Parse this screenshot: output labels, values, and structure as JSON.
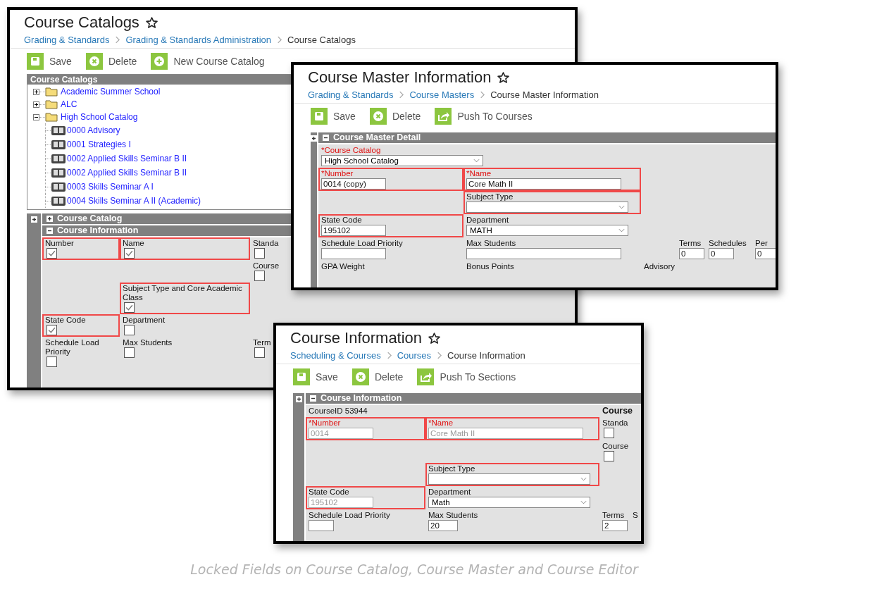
{
  "panels": [
    {
      "kind": "catalog",
      "title": "Course Catalogs",
      "breadcrumb": [
        "Grading & Standards",
        "Grading & Standards Administration",
        "Course Catalogs"
      ],
      "toolbar": [
        {
          "kind": "save",
          "label": "Save"
        },
        {
          "kind": "delete",
          "label": "Delete"
        },
        {
          "kind": "add",
          "label": "New Course Catalog"
        }
      ],
      "tree": {
        "title": "Course Catalogs",
        "items": [
          {
            "kind": "folder",
            "label": "Academic Summer School",
            "expanded": false
          },
          {
            "kind": "folder",
            "label": "ALC",
            "expanded": false
          },
          {
            "kind": "folder",
            "label": "High School Catalog",
            "expanded": true,
            "children": [
              {
                "kind": "course",
                "label": "0000 Advisory"
              },
              {
                "kind": "course",
                "label": "0001 Strategies I"
              },
              {
                "kind": "course",
                "label": "0002 Applied Skills Seminar B II"
              },
              {
                "kind": "course",
                "label": "0002 Applied Skills Seminar B II"
              },
              {
                "kind": "course",
                "label": "0003 Skills Seminar A I"
              },
              {
                "kind": "course",
                "label": "0004 Skills Seminar A II (Academic)"
              }
            ]
          }
        ]
      },
      "sections": [
        {
          "label": "Course Catalog",
          "expanded": false
        },
        {
          "label": "Course Information",
          "expanded": true
        }
      ],
      "rows": [
        [
          {
            "kind": "checkbox",
            "label": "Number",
            "checked": true,
            "locked": true
          },
          {
            "kind": "checkbox",
            "label": "Name",
            "checked": true,
            "locked": true
          },
          {
            "kind": "checkbox",
            "label": "Standa",
            "checked": false,
            "locked": false
          }
        ],
        [
          "",
          "",
          {
            "kind": "checkbox",
            "label": "Course",
            "checked": false,
            "locked": false
          }
        ],
        [
          "",
          {
            "kind": "checkbox",
            "label": "Subject Type and Core Academic Class",
            "checked": true,
            "locked": true
          }
        ],
        [
          {
            "kind": "checkbox",
            "label": "State Code",
            "checked": true,
            "locked": true
          },
          {
            "kind": "checkbox",
            "label": "Department",
            "checked": false,
            "locked": false
          }
        ],
        [
          {
            "kind": "checkbox",
            "label": "Schedule Load Priority",
            "checked": false,
            "locked": false
          },
          {
            "kind": "checkbox",
            "label": "Max Students",
            "checked": false,
            "locked": false
          },
          {
            "kind": "checkbox",
            "label": "Term",
            "checked": false,
            "locked": false
          }
        ]
      ]
    },
    {
      "kind": "master",
      "title": "Course Master Information",
      "breadcrumb": [
        "Grading & Standards",
        "Course Masters",
        "Course Master Information"
      ],
      "toolbar": [
        {
          "kind": "save",
          "label": "Save"
        },
        {
          "kind": "delete",
          "label": "Delete"
        },
        {
          "kind": "push",
          "label": "Push To Courses"
        }
      ],
      "sections": [
        {
          "label": "Course Master Detail",
          "expanded": true
        }
      ],
      "rows": [
        [
          {
            "kind": "select",
            "label": "*Course Catalog",
            "value": "High School Catalog",
            "required": true,
            "locked": false
          }
        ],
        [
          {
            "kind": "input",
            "label": "*Number",
            "value": "0014 (copy)",
            "required": true,
            "locked": true,
            "disabled": false
          },
          {
            "kind": "input",
            "label": "*Name",
            "value": "Core Math II",
            "required": true,
            "locked": true,
            "disabled": false
          }
        ],
        [
          "",
          {
            "kind": "select",
            "label": "Subject Type",
            "required": false,
            "locked": true
          }
        ],
        [
          {
            "kind": "input",
            "label": "State Code",
            "value": "195102",
            "required": false,
            "locked": true,
            "disabled": false
          },
          {
            "kind": "select",
            "label": "Department",
            "value": "MATH",
            "required": false,
            "locked": false
          }
        ],
        [
          {
            "kind": "input",
            "label": "Schedule Load Priority",
            "required": false,
            "locked": false,
            "disabled": false
          },
          {
            "kind": "input",
            "label": "Max Students",
            "required": false,
            "locked": false,
            "disabled": false
          },
          "",
          {
            "kind": "input",
            "label": "Terms",
            "value": "0",
            "required": false,
            "locked": false,
            "disabled": false
          },
          {
            "kind": "input",
            "label": "Schedules",
            "value": "0",
            "required": false,
            "locked": false,
            "disabled": false
          },
          {
            "kind": "input",
            "label": "Per",
            "value": "0",
            "required": false,
            "locked": false,
            "disabled": false
          }
        ],
        [
          {
            "kind": "label",
            "label": "GPA Weight",
            "required": false,
            "locked": false
          },
          {
            "kind": "label",
            "label": "Bonus Points",
            "required": false,
            "locked": false
          },
          {
            "kind": "label",
            "label": "Advisory",
            "required": false,
            "locked": false
          }
        ]
      ]
    },
    {
      "kind": "course",
      "title": "Course Information",
      "breadcrumb": [
        "Scheduling & Courses",
        "Courses",
        "Course Information"
      ],
      "toolbar": [
        {
          "kind": "save",
          "label": "Save"
        },
        {
          "kind": "delete",
          "label": "Delete"
        },
        {
          "kind": "push",
          "label": "Push To Sections"
        }
      ],
      "sections": [
        {
          "label": "Course Information",
          "expanded": true
        }
      ],
      "rows": [
        [
          {
            "kind": "text",
            "label": "CourseID 53944",
            "required": false,
            "locked": false
          },
          "",
          {
            "kind": "heading",
            "label": "Course",
            "locked": false
          }
        ],
        [
          {
            "kind": "input",
            "label": "*Number",
            "value": "0014",
            "required": true,
            "locked": true,
            "disabled": true
          },
          {
            "kind": "input",
            "label": "*Name",
            "value": "Core Math II",
            "required": true,
            "locked": true,
            "disabled": true
          },
          {
            "kind": "checkbox",
            "label": "Standa",
            "checked": false,
            "required": false,
            "locked": false
          }
        ],
        [
          "",
          "",
          {
            "kind": "checkbox",
            "label": "Course",
            "checked": false,
            "required": false,
            "locked": false
          }
        ],
        [
          "",
          {
            "kind": "select",
            "label": "Subject Type",
            "required": false,
            "locked": true
          }
        ],
        [
          {
            "kind": "input",
            "label": "State Code",
            "value": "195102",
            "required": false,
            "locked": true,
            "disabled": true
          },
          {
            "kind": "select",
            "label": "Department",
            "value": "Math",
            "required": false,
            "locked": false
          }
        ],
        [
          {
            "kind": "input",
            "label": "Schedule Load Priority",
            "required": false,
            "locked": false,
            "disabled": false
          },
          {
            "kind": "input",
            "label": "Max Students",
            "value": "20",
            "required": false,
            "locked": false,
            "disabled": false
          },
          {
            "kind": "input",
            "label": "Terms",
            "value": "2",
            "required": false,
            "locked": false,
            "disabled": false
          },
          {
            "kind": "label",
            "label": "S",
            "required": false,
            "locked": false
          }
        ]
      ]
    }
  ],
  "caption": "Locked Fields on Course Catalog, Course Master and Course Editor"
}
